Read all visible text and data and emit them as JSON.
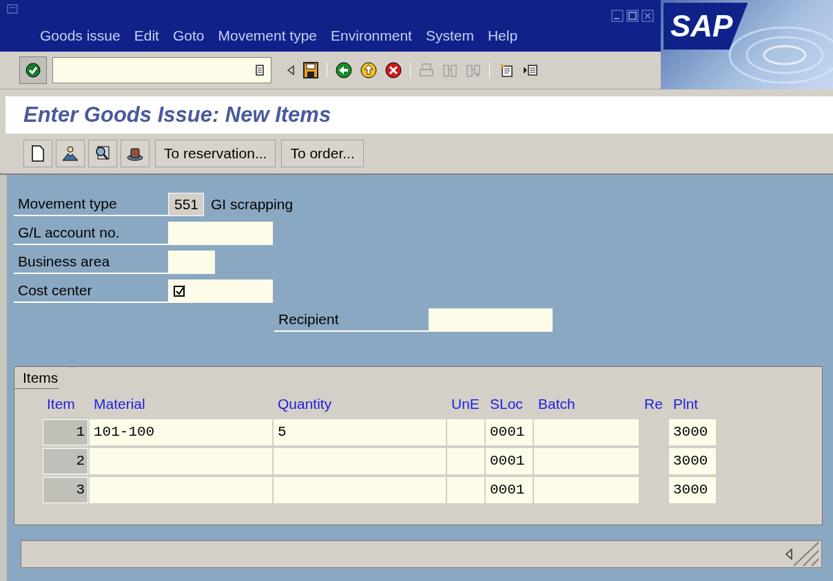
{
  "logo": "SAP",
  "menu": [
    "Goods issue",
    "Edit",
    "Goto",
    "Movement type",
    "Environment",
    "System",
    "Help"
  ],
  "toolbar": [
    {
      "kind": "enter",
      "disabled": false
    },
    {
      "kind": "command-field"
    },
    {
      "kind": "prev",
      "disabled": false
    },
    {
      "kind": "save",
      "disabled": false
    },
    {
      "kind": "sep"
    },
    {
      "kind": "back",
      "disabled": false
    },
    {
      "kind": "exit",
      "disabled": false
    },
    {
      "kind": "cancel",
      "disabled": false
    },
    {
      "kind": "sep"
    },
    {
      "kind": "print",
      "disabled": true
    },
    {
      "kind": "find",
      "disabled": true
    },
    {
      "kind": "find-next",
      "disabled": true
    },
    {
      "kind": "sep"
    },
    {
      "kind": "new-session",
      "disabled": false
    },
    {
      "kind": "layout",
      "disabled": false
    }
  ],
  "title": "Enter Goods Issue: New Items",
  "app_toolbar": {
    "icons": [
      {
        "kind": "new-document"
      },
      {
        "kind": "person"
      },
      {
        "kind": "search-document"
      },
      {
        "kind": "hat"
      }
    ],
    "buttons": [
      "To reservation...",
      "To order..."
    ]
  },
  "fields": [
    {
      "label": "Movement type",
      "value": "551",
      "disabled": true,
      "description": "GI scrapping",
      "required": false
    },
    {
      "label": "G/L account no.",
      "disabled": false,
      "required": false
    },
    {
      "label": "Business area",
      "disabled": false,
      "required": false
    },
    {
      "label": "Cost center",
      "disabled": false,
      "required": true
    }
  ],
  "recipient": {
    "label": "Recipient"
  },
  "items": {
    "title": "Items",
    "columns": [
      "Item",
      "Material",
      "Quantity",
      "UnE",
      "SLoc",
      "Batch",
      "Re",
      "Plnt"
    ],
    "rows": [
      [
        "1",
        "101-100",
        "5",
        "",
        "0001",
        "",
        "",
        "3000"
      ],
      [
        "2",
        "",
        "",
        "",
        "0001",
        "",
        "",
        "3000"
      ],
      [
        "3",
        "",
        "",
        "",
        "0001",
        "",
        "",
        "3000"
      ]
    ]
  }
}
